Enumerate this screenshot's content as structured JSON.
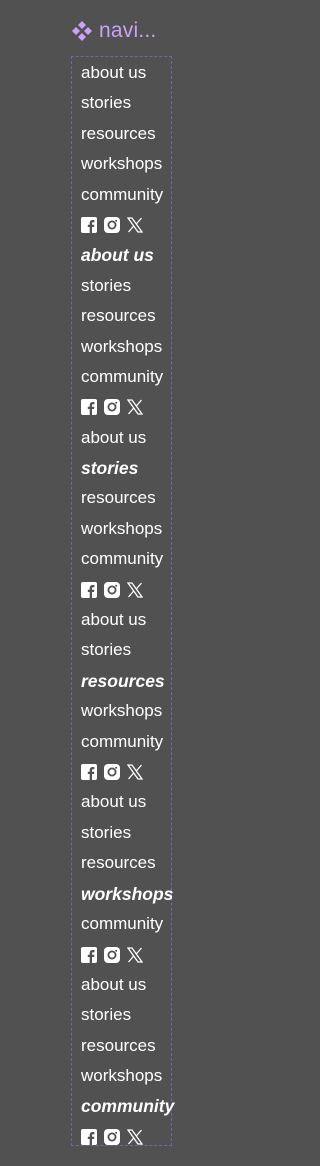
{
  "header": {
    "title": "navi...",
    "icon": "diamond-cluster-icon",
    "color": "#c9a3f5"
  },
  "colors": {
    "background": "#515151",
    "text": "#ffffff",
    "frame_border": "#7d62a3"
  },
  "groups": [
    {
      "active_index": -1,
      "items": [
        "about us",
        "stories",
        "resources",
        "workshops",
        "community"
      ],
      "social": [
        "facebook-icon",
        "instagram-icon",
        "x-icon"
      ]
    },
    {
      "active_index": 0,
      "items": [
        "about us",
        "stories",
        "resources",
        "workshops",
        "community"
      ],
      "social": [
        "facebook-icon",
        "instagram-icon",
        "x-icon"
      ]
    },
    {
      "active_index": 1,
      "items": [
        "about us",
        "stories",
        "resources",
        "workshops",
        "community"
      ],
      "social": [
        "facebook-icon",
        "instagram-icon",
        "x-icon"
      ]
    },
    {
      "active_index": 2,
      "items": [
        "about us",
        "stories",
        "resources",
        "workshops",
        "community"
      ],
      "social": [
        "facebook-icon",
        "instagram-icon",
        "x-icon"
      ]
    },
    {
      "active_index": 3,
      "items": [
        "about us",
        "stories",
        "resources",
        "workshops",
        "community"
      ],
      "social": [
        "facebook-icon",
        "instagram-icon",
        "x-icon"
      ]
    },
    {
      "active_index": 4,
      "items": [
        "about us",
        "stories",
        "resources",
        "workshops",
        "community"
      ],
      "social": [
        "facebook-icon",
        "instagram-icon",
        "x-icon"
      ]
    }
  ]
}
